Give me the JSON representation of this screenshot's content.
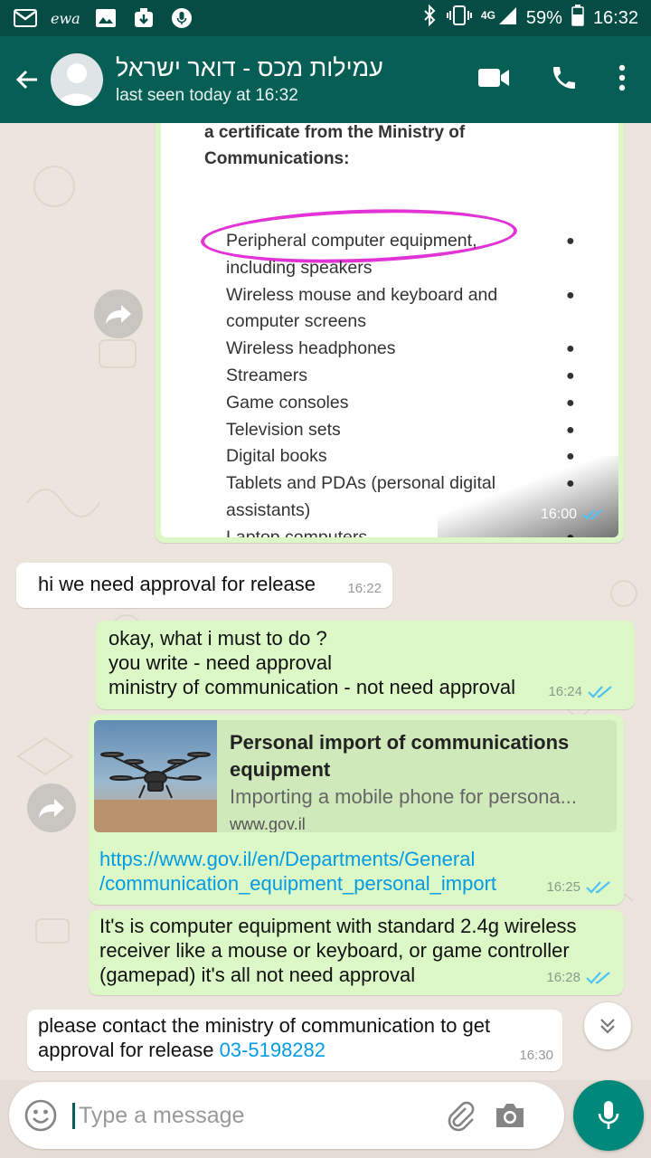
{
  "status_bar": {
    "carrier_label": "ewa",
    "network": "4G",
    "battery": "59%",
    "clock": "16:32"
  },
  "header": {
    "title": "עמילות מכס - דואר ישראל",
    "subtitle": "last seen today at 16:32"
  },
  "image_message": {
    "doc_heading": [
      "a certificate from the Ministry of",
      "Communications:"
    ],
    "items": [
      "Peripheral computer equipment,",
      "including speakers",
      "Wireless mouse and keyboard and",
      "computer screens",
      "Wireless headphones",
      "Streamers",
      "Game consoles",
      "Television sets",
      "Digital books",
      "Tablets and PDAs (personal digital",
      "assistants)",
      "Laptop computers"
    ],
    "time": "16:00"
  },
  "messages": {
    "m1": {
      "text": "hi we need approval for release",
      "time": "16:22"
    },
    "m2": {
      "line1": "okay, what i must to do ?",
      "line2": "you write - need approval",
      "line3": "ministry of communication - not need approval",
      "time": "16:24"
    },
    "m3": {
      "preview_title": "Personal import of communications equipment",
      "preview_desc": "Importing a mobile phone for persona...",
      "preview_domain": "www.gov.il",
      "link_line1": "https://www.gov.il/en/Departments/General",
      "link_line2": "/communication_equipment_personal_import",
      "time": "16:25"
    },
    "m4": {
      "line1": "It's is computer equipment with standard 2.4g wireless",
      "line2": "receiver like a mouse or keyboard, or game controller",
      "line3": "(gamepad) it's all not need approval",
      "time": "16:28"
    },
    "m5": {
      "line1": "please contact the ministry of communication to get",
      "line2_text": "approval for release ",
      "phone": "03-5198282",
      "time": "16:30"
    }
  },
  "input": {
    "placeholder": "Type a message"
  },
  "colors": {
    "header": "#075e54",
    "status_bar": "#054d44",
    "outgoing": "#dcf8c6",
    "incoming": "#ffffff",
    "tick_read": "#4fc3f7",
    "link": "#039be5",
    "fab": "#00897b"
  }
}
